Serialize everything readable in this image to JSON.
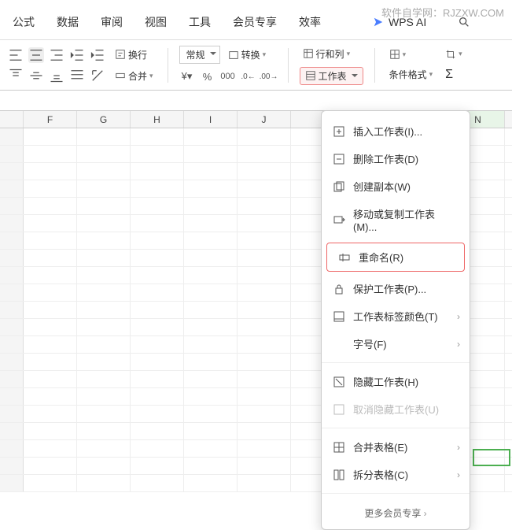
{
  "watermark": "软件自学网：RJZXW.COM",
  "menubar": {
    "items": [
      "公式",
      "数据",
      "审阅",
      "视图",
      "工具",
      "会员专享",
      "效率"
    ],
    "wps_ai": "WPS AI"
  },
  "toolbar": {
    "wrap": "换行",
    "merge": "合并",
    "normal": "常规",
    "convert": "转换",
    "rowcol": "行和列",
    "worksheet": "工作表",
    "condfmt": "条件格式"
  },
  "columns": [
    "F",
    "G",
    "H",
    "I",
    "J",
    "",
    "",
    "",
    "N"
  ],
  "menu": {
    "insert": "插入工作表(I)...",
    "delete": "删除工作表(D)",
    "copy": "创建副本(W)",
    "move": "移动或复制工作表(M)...",
    "rename": "重命名(R)",
    "protect": "保护工作表(P)...",
    "tabcolor": "工作表标签颜色(T)",
    "font": "字号(F)",
    "hide": "隐藏工作表(H)",
    "unhide": "取消隐藏工作表(U)",
    "mergetbl": "合并表格(E)",
    "splittbl": "拆分表格(C)",
    "more": "更多会员专享"
  }
}
